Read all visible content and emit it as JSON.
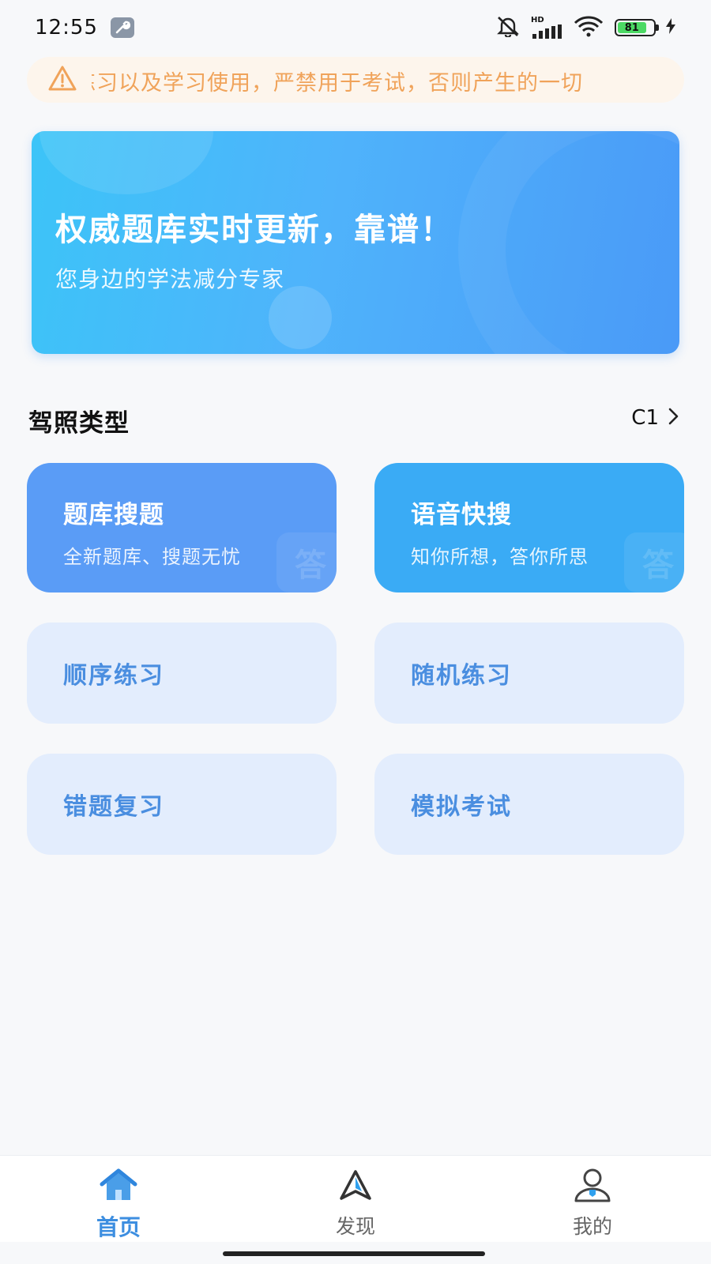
{
  "status_bar": {
    "time": "12:55",
    "battery_level": "81",
    "network_label": "HD",
    "icons": [
      "wrench-icon",
      "bell-muted-icon",
      "signal-icon",
      "wifi-icon",
      "battery-icon",
      "charging-icon"
    ]
  },
  "notice": {
    "text": "练习以及学习使用，严禁用于考试，否则产生的一切",
    "icon": "warning-icon",
    "color": "#f0a35a"
  },
  "banner": {
    "title": "权威题库实时更新，靠谱！",
    "subtitle": "您身边的学法减分专家"
  },
  "license": {
    "section_title": "驾照类型",
    "value": "C1"
  },
  "features": [
    {
      "title": "题库搜题",
      "subtitle": "全新题库、搜题无忧",
      "badge": "答"
    },
    {
      "title": "语音快搜",
      "subtitle": "知你所想，答你所思",
      "badge": "答"
    }
  ],
  "practice": [
    {
      "label": "顺序练习"
    },
    {
      "label": "随机练习"
    },
    {
      "label": "错题复习"
    },
    {
      "label": "模拟考试"
    }
  ],
  "nav": [
    {
      "label": "首页",
      "icon": "home-icon",
      "active": true
    },
    {
      "label": "发现",
      "icon": "discover-icon",
      "active": false
    },
    {
      "label": "我的",
      "icon": "profile-icon",
      "active": false
    }
  ],
  "colors": {
    "accent": "#3d8ee0",
    "feature_search": "#5a9cf6",
    "feature_voice": "#3aabf5",
    "practice_bg": "#e3edfd",
    "practice_text": "#4a8ee0"
  }
}
